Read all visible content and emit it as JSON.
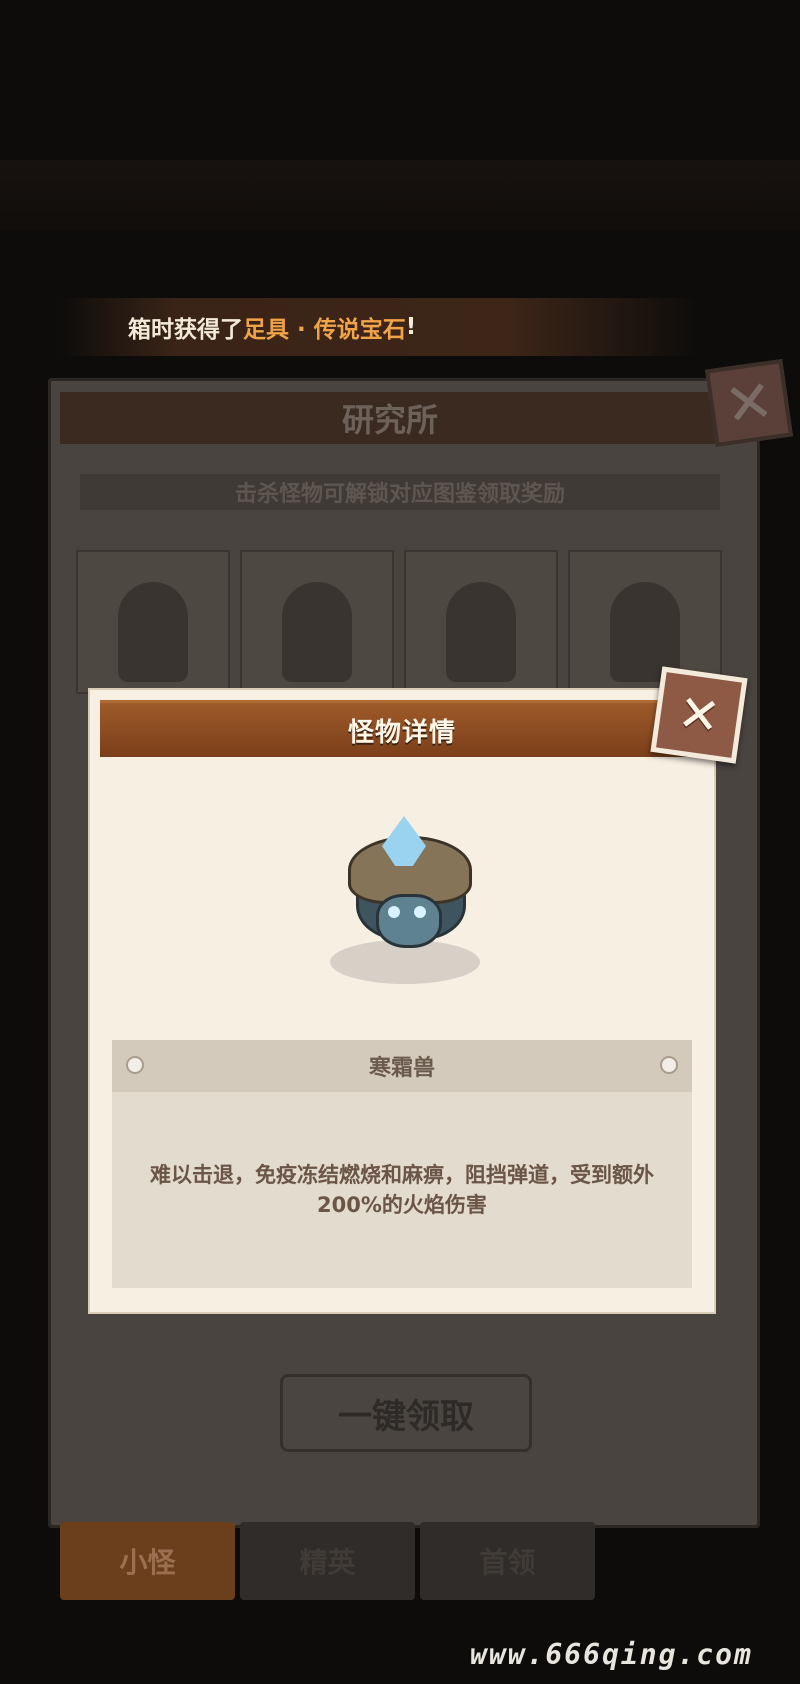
{
  "notice": {
    "prefix": "箱时获得了",
    "highlight": "足具 · 传说宝石",
    "suffix": "!"
  },
  "research_panel": {
    "title": "研究所",
    "subtitle": "击杀怪物可解锁对应图鉴领取奖励",
    "claim_all_button": "一键领取",
    "tabs": [
      "小怪",
      "精英",
      "首领"
    ]
  },
  "modal": {
    "title": "怪物详情",
    "monster_name": "寒霜兽",
    "description": "难以击退，免疫冻结燃烧和麻痹，阻挡弹道，受到额外200%的火焰伤害"
  },
  "watermark": "www.666qing.com",
  "colors": {
    "header_brown": "#8a4a20",
    "highlight_orange": "#f0a348",
    "modal_bg": "#f7efe2"
  }
}
